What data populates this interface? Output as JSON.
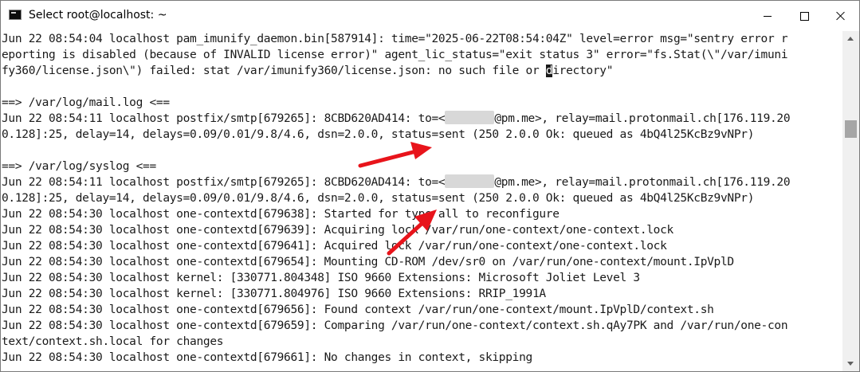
{
  "window": {
    "title": "Select root@localhost: ~"
  },
  "terminal": {
    "lines": [
      "Jun 22 08:54:04 localhost pam_imunify_daemon.bin[587914]: time=\"2025-06-22T08:54:04Z\" level=error msg=\"sentry error r",
      "eporting is disabled (because of INVALID license error)\" agent_lic_status=\"exit status 3\" error=\"fs.Stat(\\\"/var/imuni",
      "fy360/license.json\\\") failed: stat /var/imunify360/license.json: no such file or directory\"",
      "",
      "==> /var/log/mail.log <==",
      "Jun 22 08:54:11 localhost postfix/smtp[679265]: 8CBD620AD414: to=<{R}@pm.me>, relay=mail.protonmail.ch[176.119.20",
      "0.128]:25, delay=14, delays=0.09/0.01/9.8/4.6, dsn=2.0.0, status=sent (250 2.0.0 Ok: queued as 4bQ4l25KcBz9vNPr)",
      "",
      "==> /var/log/syslog <==",
      "Jun 22 08:54:11 localhost postfix/smtp[679265]: 8CBD620AD414: to=<{R}@pm.me>, relay=mail.protonmail.ch[176.119.20",
      "0.128]:25, delay=14, delays=0.09/0.01/9.8/4.6, dsn=2.0.0, status=sent (250 2.0.0 Ok: queued as 4bQ4l25KcBz9vNPr)",
      "Jun 22 08:54:30 localhost one-contextd[679638]: Started for type all to reconfigure",
      "Jun 22 08:54:30 localhost one-contextd[679639]: Acquiring lock /var/run/one-context/one-context.lock",
      "Jun 22 08:54:30 localhost one-contextd[679641]: Acquired lock /var/run/one-context/one-context.lock",
      "Jun 22 08:54:30 localhost one-contextd[679654]: Mounting CD-ROM /dev/sr0 on /var/run/one-context/mount.IpVplD",
      "Jun 22 08:54:30 localhost kernel: [330771.804348] ISO 9660 Extensions: Microsoft Joliet Level 3",
      "Jun 22 08:54:30 localhost kernel: [330771.804976] ISO 9660 Extensions: RRIP_1991A",
      "Jun 22 08:54:30 localhost one-contextd[679656]: Found context /var/run/one-context/mount.IpVplD/context.sh",
      "Jun 22 08:54:30 localhost one-contextd[679659]: Comparing /var/run/one-context/context.sh.qAy7PK and /var/run/one-con",
      "text/context.sh.local for changes",
      "Jun 22 08:54:30 localhost one-contextd[679661]: No changes in context, skipping"
    ]
  },
  "colors": {
    "arrow": "#e8141b",
    "text": "#1a1a1a",
    "background": "#ffffff"
  },
  "icons": {
    "app": "terminal-icon",
    "minimize": "minimize-icon",
    "maximize": "maximize-icon",
    "close": "close-icon"
  }
}
